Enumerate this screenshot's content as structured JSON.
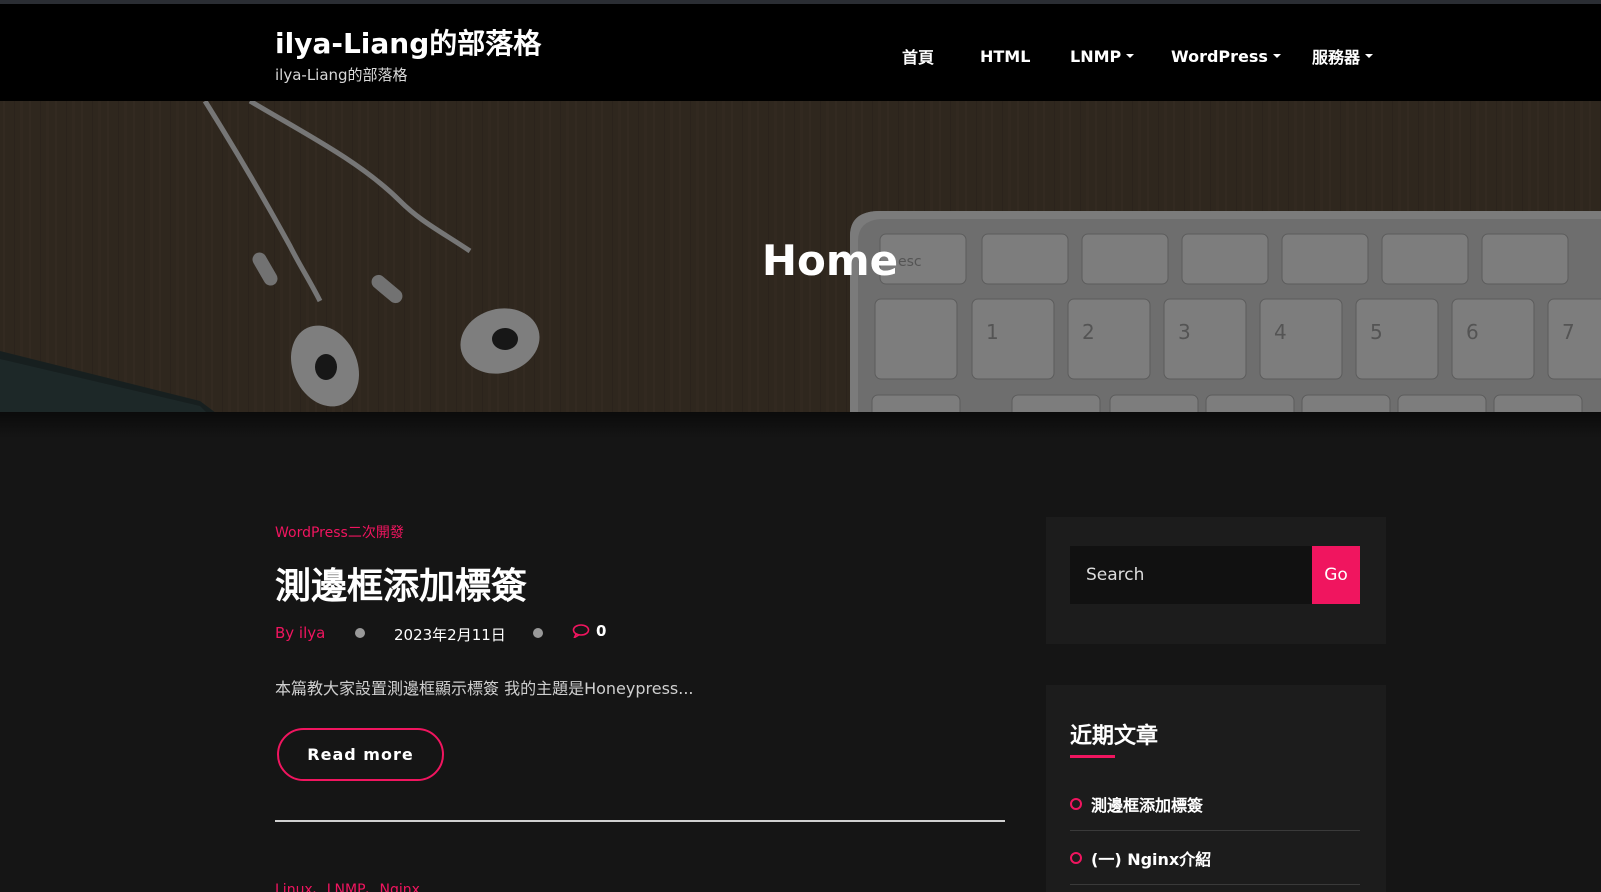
{
  "header": {
    "site_title": "ilya-Liang的部落格",
    "site_tagline": "ilya-Liang的部落格",
    "nav": [
      {
        "label": "首頁",
        "has_dropdown": false
      },
      {
        "label": "HTML",
        "has_dropdown": false
      },
      {
        "label": "LNMP",
        "has_dropdown": true
      },
      {
        "label": "WordPress",
        "has_dropdown": true
      },
      {
        "label": "服務器",
        "has_dropdown": true
      }
    ]
  },
  "hero": {
    "title": "Home",
    "keyboard_keys": [
      "esc",
      "1",
      "2",
      "3",
      "4",
      "5",
      "6",
      "7"
    ]
  },
  "post": {
    "category": "WordPress二次開發",
    "title": "測邊框添加標簽",
    "author": "By ilya",
    "date": "2023年2月11日",
    "comments": "0",
    "excerpt": "本篇教大家設置測邊框顯示標簽 我的主題是Honeypress...",
    "read_more": "Read more"
  },
  "next_post": {
    "category": "Linux、LNMP、Nginx"
  },
  "sidebar": {
    "search": {
      "placeholder": "Search",
      "button": "Go"
    },
    "recent": {
      "heading": "近期文章",
      "items": [
        "測邊框添加標簽",
        "(一) Nginx介紹"
      ]
    }
  },
  "colors": {
    "accent": "#f0155f",
    "header_bg": "#000000",
    "page_bg": "#151515",
    "widget_bg": "#1c1c1c"
  },
  "icons": {
    "comment": "comment-bubble-icon",
    "dropdown": "caret-down-icon",
    "list_bullet": "ring-bullet-icon"
  }
}
